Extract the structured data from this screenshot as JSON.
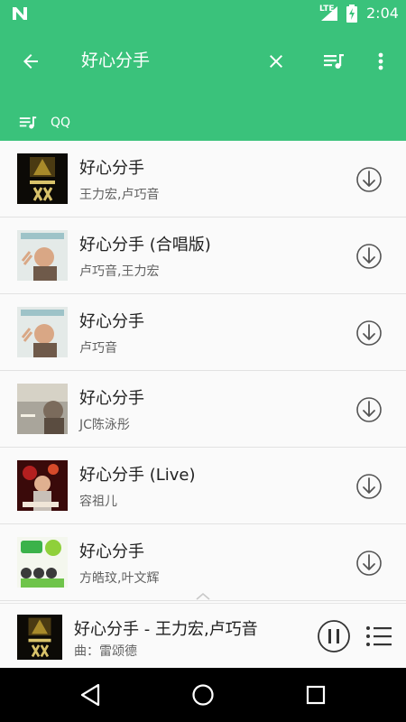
{
  "status_bar": {
    "network_label": "LTE",
    "time": "2:04"
  },
  "app_bar": {
    "query": "好心分手",
    "source_label": "QQ"
  },
  "songs": [
    {
      "title": "好心分手",
      "artist": "王力宏,卢巧音"
    },
    {
      "title": "好心分手 (合唱版)",
      "artist": "卢巧音,王力宏"
    },
    {
      "title": "好心分手",
      "artist": "卢巧音"
    },
    {
      "title": "好心分手",
      "artist": "JC陈泳彤"
    },
    {
      "title": "好心分手 (Live)",
      "artist": "容祖儿"
    },
    {
      "title": "好心分手",
      "artist": "方皓玟,叶文辉"
    }
  ],
  "now_playing": {
    "title": "好心分手 - 王力宏,卢巧音",
    "subtitle": "曲：雷颂德"
  },
  "colors": {
    "primary": "#3ac27b",
    "icon_gray": "#555555"
  },
  "icons": {
    "back": "arrow-left",
    "clear": "close",
    "queue": "queue-music",
    "more": "more-vert",
    "download": "download-circle",
    "pause": "pause-circle",
    "playlist": "format-list-bulleted"
  }
}
